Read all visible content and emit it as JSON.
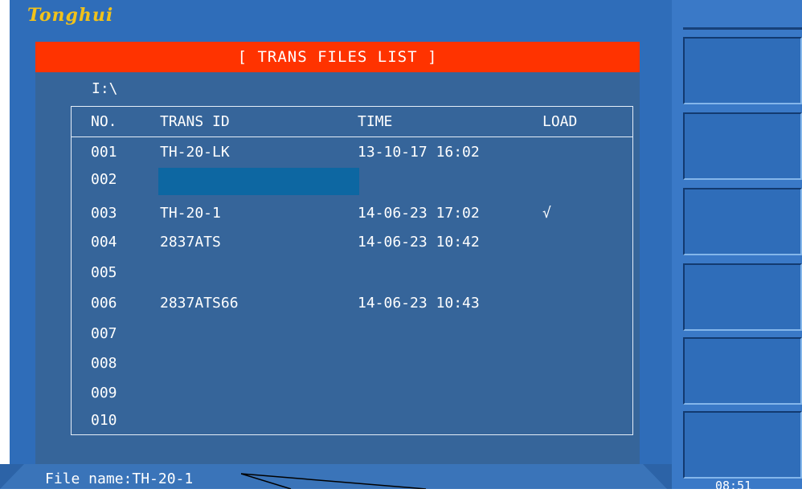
{
  "brand": {
    "logo_text": "Tonghui"
  },
  "dialog": {
    "title": "[ TRANS FILES LIST ]",
    "path": "I:\\"
  },
  "table": {
    "headers": [
      "NO.",
      "TRANS ID",
      "TIME",
      "LOAD"
    ],
    "rows": [
      {
        "no": "001",
        "id": "TH-20-LK",
        "time": "13-10-17 16:02",
        "load": ""
      },
      {
        "no": "002",
        "id": "",
        "time": "",
        "load": ""
      },
      {
        "no": "003",
        "id": "TH-20-1",
        "time": "14-06-23 17:02",
        "load": "√"
      },
      {
        "no": "004",
        "id": "2837ATS",
        "time": "14-06-23 10:42",
        "load": ""
      },
      {
        "no": "005",
        "id": "",
        "time": "",
        "load": ""
      },
      {
        "no": "006",
        "id": "2837ATS66",
        "time": "14-06-23 10:43",
        "load": ""
      },
      {
        "no": "007",
        "id": "",
        "time": "",
        "load": ""
      },
      {
        "no": "008",
        "id": "",
        "time": "",
        "load": ""
      },
      {
        "no": "009",
        "id": "",
        "time": "",
        "load": ""
      },
      {
        "no": "010",
        "id": "",
        "time": "",
        "load": ""
      }
    ],
    "selected_row_no": "002"
  },
  "status": {
    "file_name_text": "File name:TH-20-1",
    "clock": "08:51"
  },
  "softkeys": [
    "",
    "",
    "",
    "",
    "",
    ""
  ],
  "colors": {
    "screen_bg": "#2f6db9",
    "panel_bg": "#36659a",
    "title_bar": "#ff3300",
    "selection": "#0d67a2",
    "logo": "#f1c21b"
  }
}
